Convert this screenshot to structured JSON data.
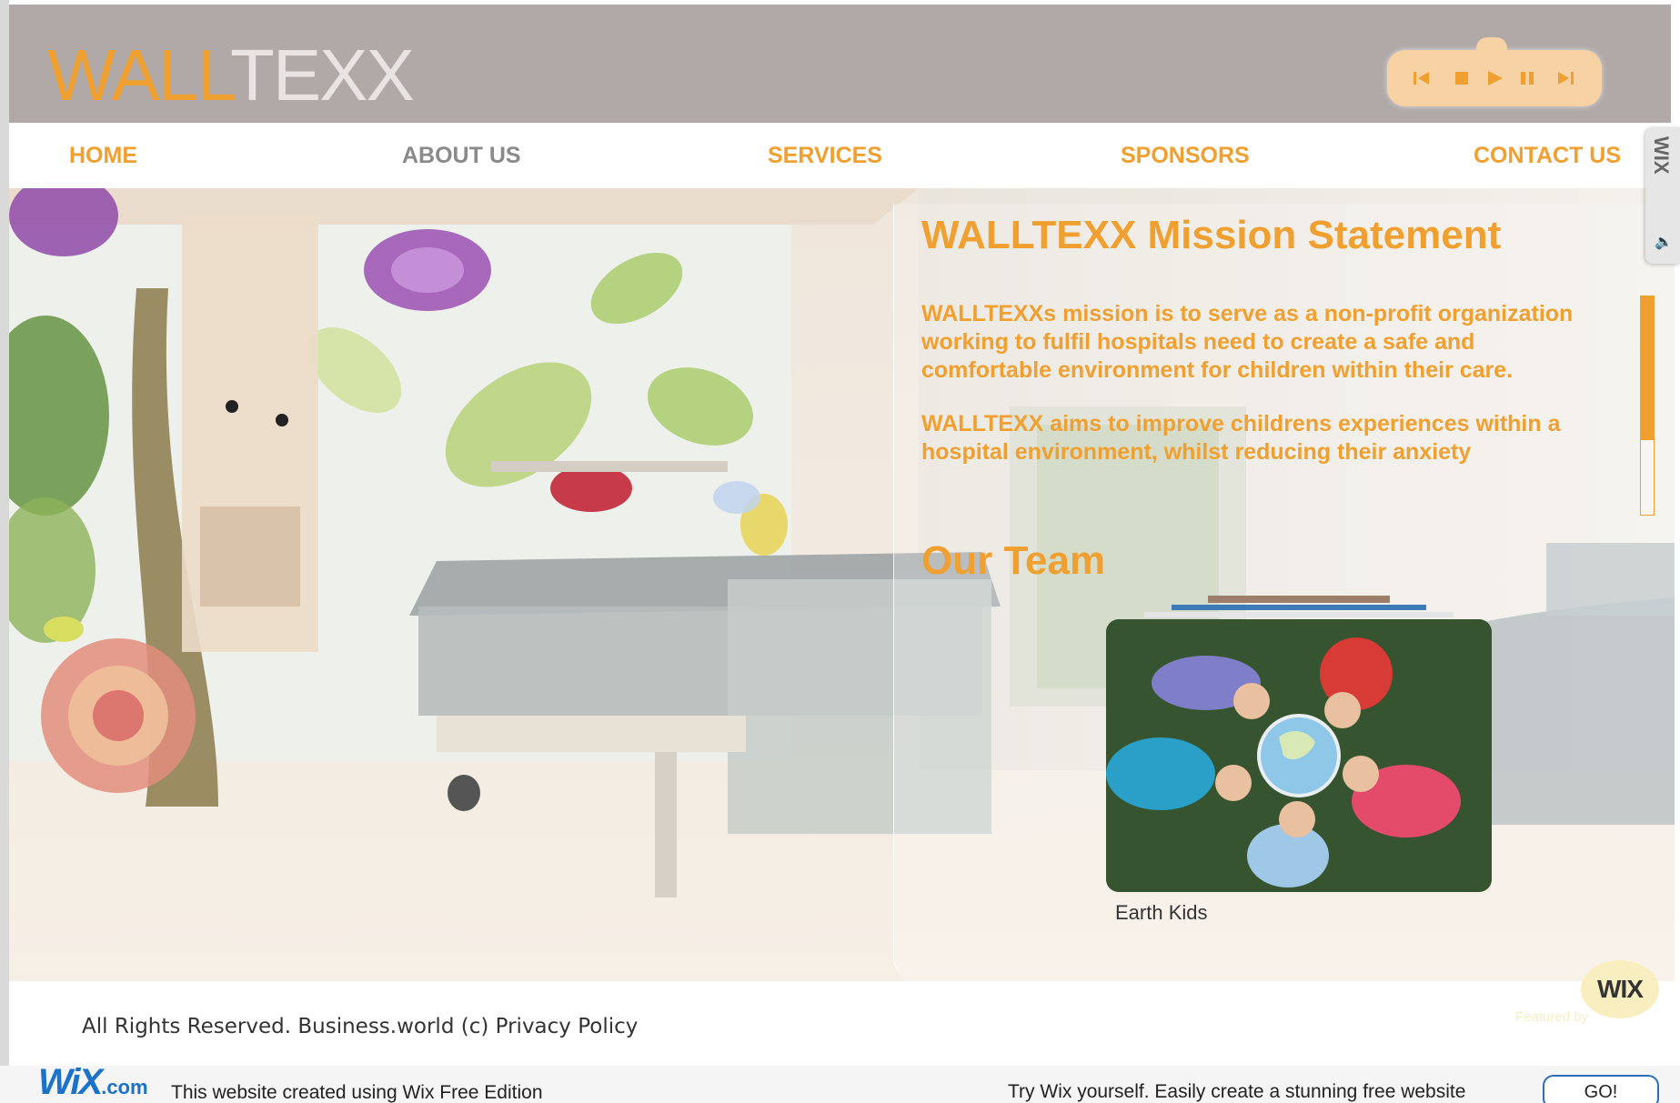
{
  "logo": {
    "part1": "WALL",
    "part2": "TEXX"
  },
  "player": {
    "buttons": [
      "previous-icon",
      "stop-icon",
      "play-icon",
      "pause-icon",
      "next-icon"
    ]
  },
  "nav": {
    "items": [
      {
        "label": "HOME"
      },
      {
        "label": "ABOUT US"
      },
      {
        "label": "SERVICES"
      },
      {
        "label": "SPONSORS"
      },
      {
        "label": "CONTACT US"
      }
    ]
  },
  "main": {
    "mission_title": "WALLTEXX Mission Statement",
    "paragraphs": [
      "WALLTEXXs mission is to serve as a non-profit organization working to fulfil hospitals need to create a safe and comfortable environment for children within their care.",
      "WALLTEXX aims to improve childrens experiences within a hospital environment, whilst reducing their anxiety"
    ],
    "team_title": "Our Team",
    "photo_caption": "Earth Kids",
    "scroll_fraction": 0.66
  },
  "side_badge": {
    "label": "WIX"
  },
  "footer": {
    "copyright": "All Rights Reserved. Business.world (c) Privacy Policy",
    "badge": "WIX",
    "featured": "Featured by"
  },
  "wix_bar": {
    "logo": "WiX",
    "logo_suffix": ".com",
    "created": "This website created using Wix Free Edition",
    "try": "Try Wix yourself. Easily create a stunning free website",
    "go": "GO!"
  },
  "colors": {
    "accent": "#f0a030",
    "header_bg": "#b0a9a8",
    "player_bg": "#f6d2a4"
  }
}
